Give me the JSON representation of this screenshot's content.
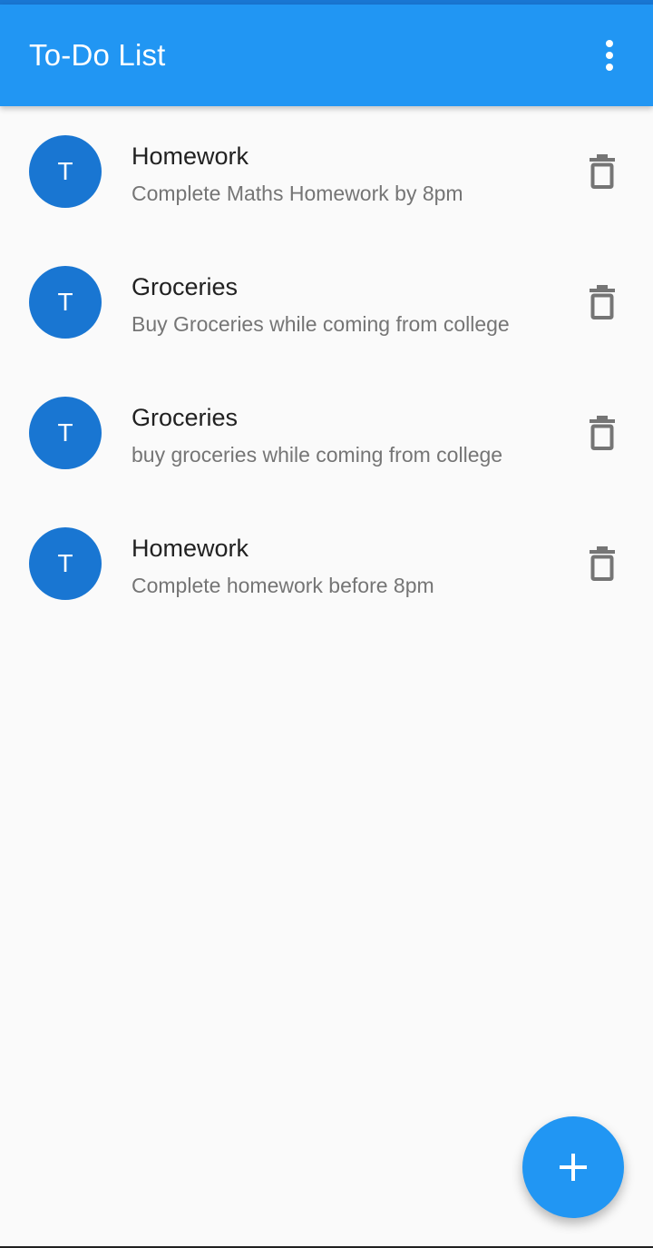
{
  "app_bar": {
    "title": "To-Do List",
    "menu_icon": "more-vertical-icon",
    "background_color": "#2196f3",
    "status_strip_color": "#1976d2"
  },
  "todos": [
    {
      "avatar_letter": "T",
      "title": "Homework",
      "description": "Complete Maths Homework by 8pm",
      "action_icon": "delete-icon"
    },
    {
      "avatar_letter": "T",
      "title": "Groceries",
      "description": "Buy Groceries while coming from college",
      "action_icon": "delete-icon"
    },
    {
      "avatar_letter": "T",
      "title": "Groceries",
      "description": "buy groceries while coming from college",
      "action_icon": "delete-icon"
    },
    {
      "avatar_letter": "T",
      "title": "Homework",
      "description": "Complete homework before 8pm",
      "action_icon": "delete-icon"
    }
  ],
  "fab": {
    "icon": "plus-icon",
    "color": "#2196f3"
  },
  "colors": {
    "avatar": "#1976d2",
    "delete_icon": "#757575",
    "background": "#fafafa"
  }
}
